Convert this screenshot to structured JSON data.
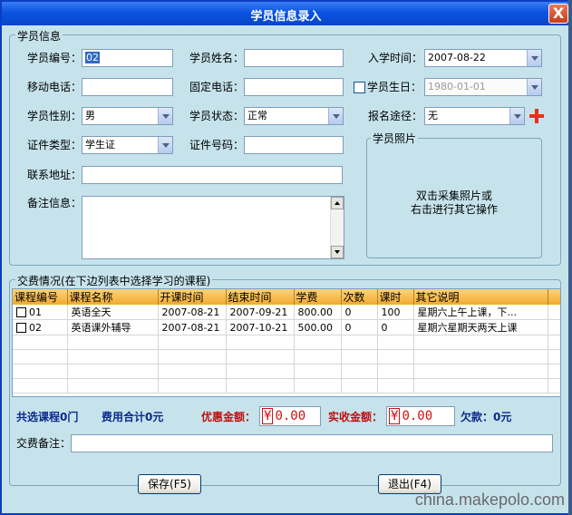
{
  "window": {
    "title": "学员信息录入",
    "close": "X"
  },
  "student": {
    "legend": "学员信息",
    "id_label": "学员编号：",
    "id_value": "02",
    "name_label": "学员姓名：",
    "name_value": "",
    "enroll_label": "入学时间：",
    "enroll_value": "2007-08-22",
    "mobile_label": "移动电话：",
    "mobile_value": "",
    "phone_label": "固定电话：",
    "phone_value": "",
    "birthday_label": "学员生日：",
    "birthday_value": "1980-01-01",
    "gender_label": "学员性别：",
    "gender_value": "男",
    "status_label": "学员状态：",
    "status_value": "正常",
    "source_label": "报名途径：",
    "source_value": "无",
    "idtype_label": "证件类型：",
    "idtype_value": "学生证",
    "idno_label": "证件号码：",
    "idno_value": "",
    "photo_legend": "学员照片",
    "photo_hint1": "双击采集照片或",
    "photo_hint2": "右击进行其它操作",
    "address_label": "联系地址：",
    "address_value": "",
    "remark_label": "备注信息：",
    "remark_value": ""
  },
  "fees": {
    "legend": "交费情况(在下边列表中选择学习的课程)",
    "columns": [
      "课程编号",
      "课程名称",
      "开课时间",
      "结束时间",
      "学费",
      "次数",
      "课时",
      "其它说明"
    ],
    "rows": [
      [
        "01",
        "英语全天",
        "2007-08-21",
        "2007-09-21",
        "800.00",
        "0",
        "100",
        "星期六上午上课，下..."
      ],
      [
        "02",
        "英语课外辅导",
        "2007-08-21",
        "2007-10-21",
        "500.00",
        "0",
        "0",
        "星期六星期天两天上课"
      ]
    ],
    "total_courses": "共选课程0门",
    "total_fee": "费用合计0元",
    "discount_label": "优惠金额：",
    "discount_value": "0.00",
    "received_label": "实收金额：",
    "received_value": "0.00",
    "yen": "¥",
    "owed": "欠款：0元",
    "note_label": "交费备注：",
    "note_value": ""
  },
  "buttons": {
    "save": "保存(F5)",
    "exit": "退出(F4)"
  },
  "watermark": "china.makepolo.com"
}
